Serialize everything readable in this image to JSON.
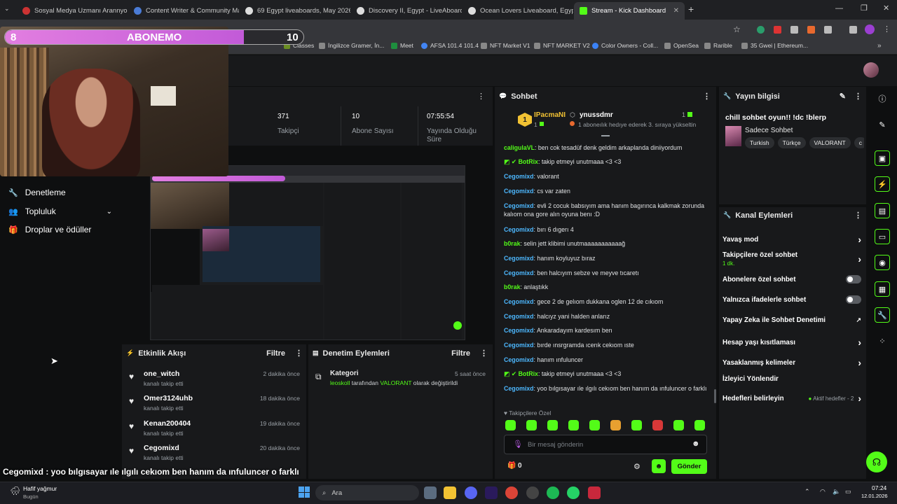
{
  "browser": {
    "tabs": [
      {
        "title": "Sosyal Medya Uzmanı Arannyor"
      },
      {
        "title": "Content Writer & Community Manager"
      },
      {
        "title": "69 Egypt liveaboards, May 2026"
      },
      {
        "title": "Discovery II, Egypt - LiveAboard"
      },
      {
        "title": "Ocean Lovers Liveaboard, Egypt"
      },
      {
        "title": "Stream - Kick Dashboard"
      }
    ],
    "bookmarks": [
      "Classes",
      "İngilizce Gramer, İn...",
      "Meet",
      "AFSA 101.4 101.4",
      "NFT Market V1",
      "NFT MARKET V2",
      "Color Owners - Coll...",
      "OpenSea",
      "Rarible",
      "35 Gwei | Ethereum..."
    ]
  },
  "overlay": {
    "sub_goal_current": "8",
    "sub_goal_label": "ABONEMO",
    "sub_goal_target": "10",
    "sub_goal_progress": 0.8,
    "ticker": "Cegomixd : yoo bılgısayar ıle ılgılı cekıom ben hanım da ınfuluncer o farklı"
  },
  "stats": [
    {
      "value": "371",
      "label": "Takipçi"
    },
    {
      "value": "10",
      "label": "Abone Sayısı"
    },
    {
      "value": "07:55:54",
      "label": "Yayında Olduğu Süre"
    }
  ],
  "nav": [
    {
      "label": "Denetleme",
      "icon": "wrench-icon"
    },
    {
      "label": "Topluluk",
      "icon": "people-icon"
    },
    {
      "label": "Droplar ve ödüller",
      "icon": "gift-icon"
    }
  ],
  "activity": {
    "title": "Etkinlik Akışı",
    "filter": "Filtre",
    "items": [
      {
        "name": "one_witch",
        "sub": "kanalı takip etti",
        "time": "2 dakika önce"
      },
      {
        "name": "Omer3124uhb",
        "sub": "kanalı takip etti",
        "time": "18 dakika önce"
      },
      {
        "name": "Kenan200404",
        "sub": "kanalı takip etti",
        "time": "19 dakika önce"
      },
      {
        "name": "Cegomixd",
        "sub": "kanalı takip etti",
        "time": "20 dakika önce"
      }
    ]
  },
  "moderation": {
    "title": "Denetim Eylemleri",
    "filter": "Filtre",
    "item": {
      "title": "Kategori",
      "time": "5 saat önce",
      "user": "leoskoll",
      "mid": " tarafından ",
      "value": "VALORANT",
      "end": " olarak değiştirildi"
    }
  },
  "chat": {
    "title": "Sohbet",
    "leader_rank": "1",
    "leader1": {
      "name": "IPacmaNI",
      "count": "1"
    },
    "leader2": {
      "name": "ynussdmr",
      "count": "1"
    },
    "leader_note": "1 aboneılık hedıye ederek 3. sıraya yükseltin",
    "messages": [
      {
        "user": "caligulaVL",
        "text": "ben cok tesadüf denk geldim arkaplanda diniiyordum",
        "kind": "green"
      },
      {
        "user": "BotRix",
        "text": "takip etmeyi unutmaaa <3 <3",
        "kind": "bot"
      },
      {
        "user": "Cegomixd",
        "text": "valorant",
        "kind": "blue"
      },
      {
        "user": "Cegomixd",
        "text": "cs var zaten",
        "kind": "blue"
      },
      {
        "user": "Cegomixd",
        "text": "evli 2 cocuk babsıyım ama hanım bagırınca kalkmak zorunda kalıom ona gore alın oyuna benı :D",
        "kind": "blue"
      },
      {
        "user": "Cegomixd",
        "text": "bırı 6 dıgerı 4",
        "kind": "blue"
      },
      {
        "user": "b0rak",
        "text": "selin jett klibimi unutmaaaaaaaaaaağ",
        "kind": "green"
      },
      {
        "user": "Cegomixd",
        "text": "hanım koyluyuz bıraz",
        "kind": "blue"
      },
      {
        "user": "Cegomixd",
        "text": "ben halcıyım sebze ve meyve tıcaretı",
        "kind": "blue"
      },
      {
        "user": "b0rak",
        "text": "anlaştıkk",
        "kind": "green"
      },
      {
        "user": "Cegomixd",
        "text": "gece 2 de gelıom dukkana oglen 12 de cıkıom",
        "kind": "blue"
      },
      {
        "user": "Cegomixd",
        "text": "halcıyz yani halden anlarız",
        "kind": "blue"
      },
      {
        "user": "Cegomixd",
        "text": "Ankaradayım kardesım ben",
        "kind": "blue"
      },
      {
        "user": "Cegomixd",
        "text": "bırde ınsrgramda ıcerık cekıom ıste",
        "kind": "blue"
      },
      {
        "user": "Cegomixd",
        "text": "hanım ınfuluncer",
        "kind": "blue"
      },
      {
        "user": "BotRix",
        "text": "takip etmeyi unutmaaa <3 <3",
        "kind": "bot"
      },
      {
        "user": "Cegomixd",
        "text": "yoo bılgısayar ıle ılgılı cekıom ben hanım da ınfuluncer o farklı",
        "kind": "blue"
      }
    ],
    "emote_label": "Takipçilere Özel",
    "input_placeholder": "Bir mesaj gönderin",
    "points": "0",
    "send_label": "Gönder"
  },
  "stream_info": {
    "title": "Yayın bilgisi",
    "stream_title": "chill sohbet oyun!! !dc !blerp",
    "category": "Sadece Sohbet",
    "tags": [
      "Turkish",
      "Türkçe",
      "VALORANT",
      "c"
    ]
  },
  "channel_actions": {
    "title": "Kanal Eylemleri",
    "rows": [
      {
        "label": "Yavaş mod",
        "type": "chevron"
      },
      {
        "label": "Takipçilere özel sohbet",
        "sub": "1 dk.",
        "type": "chevron"
      },
      {
        "label": "Abonelere özel sohbet",
        "type": "toggle"
      },
      {
        "label": "Yalnızca ifadelerle sohbet",
        "type": "toggle"
      },
      {
        "label": "Yapay Zeka ile Sohbet Denetimi",
        "type": "external"
      },
      {
        "label": "Hesap yaşı kısıtlaması",
        "type": "chevron"
      },
      {
        "label": "Yasaklanmış kelimeler",
        "type": "chevron"
      },
      {
        "label": "İzleyici Yönlendir",
        "type": "none"
      },
      {
        "label": "Hedefleri belirleyin",
        "type": "status",
        "status": "Aktif hedefler - 2"
      }
    ]
  },
  "taskbar": {
    "weather": "Hafif yağmur",
    "weather_sub": "Bugün",
    "search": "Ara",
    "time": "07:24",
    "date": "12.01.2026"
  }
}
